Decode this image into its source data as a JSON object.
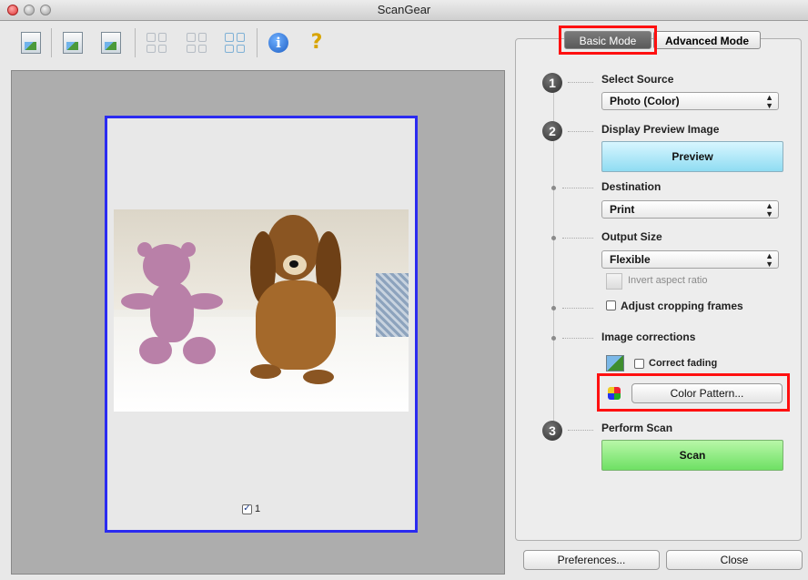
{
  "window": {
    "title": "ScanGear"
  },
  "toolbar": {
    "buttons": [
      {
        "name": "open-scanned-image-icon"
      },
      {
        "name": "scan-to-file-icon"
      },
      {
        "name": "scan-image-icon"
      },
      {
        "name": "thumbnail-view-icon"
      },
      {
        "name": "whole-image-view-icon"
      },
      {
        "name": "select-all-frames-icon"
      },
      {
        "name": "info-icon"
      },
      {
        "name": "help-icon"
      }
    ]
  },
  "preview": {
    "page_number": "1",
    "page_checked": true
  },
  "tabs": {
    "basic": "Basic Mode",
    "advanced": "Advanced Mode",
    "active": "Basic Mode"
  },
  "steps": {
    "select_source": {
      "number": "1",
      "label": "Select Source",
      "value": "Photo (Color)"
    },
    "display_preview": {
      "number": "2",
      "label": "Display Preview Image",
      "button": "Preview"
    },
    "destination": {
      "label": "Destination",
      "value": "Print"
    },
    "output_size": {
      "label": "Output Size",
      "value": "Flexible",
      "invert_label": "Invert aspect ratio"
    },
    "adjust_cropping": {
      "label": "Adjust cropping frames",
      "checked": false
    },
    "image_corrections": {
      "label": "Image corrections",
      "correct_fading": "Correct fading",
      "correct_fading_checked": false,
      "color_pattern_button": "Color Pattern..."
    },
    "perform_scan": {
      "number": "3",
      "label": "Perform Scan",
      "button": "Scan"
    }
  },
  "footer": {
    "preferences": "Preferences...",
    "close": "Close"
  },
  "colors": {
    "highlight": "#ff1010",
    "preview_button": "#8fdcf2",
    "scan_button": "#6ee064",
    "page_frame": "#2b2bf0"
  }
}
